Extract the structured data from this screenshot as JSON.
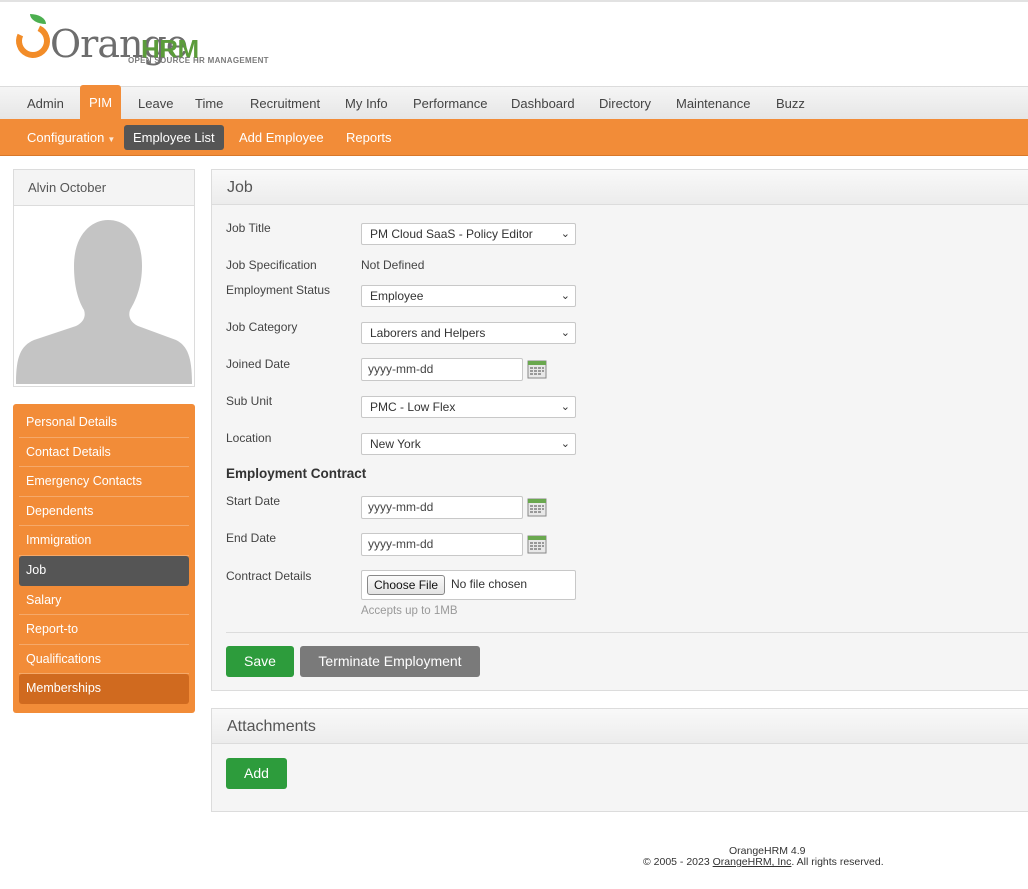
{
  "brand": {
    "logo_word": "Orange",
    "logo_hrm": "HRM",
    "logo_sub": "OPEN SOURCE HR MANAGEMENT"
  },
  "mainnav": {
    "items": [
      {
        "label": "Admin"
      },
      {
        "label": "PIM",
        "active": true
      },
      {
        "label": "Leave"
      },
      {
        "label": "Time"
      },
      {
        "label": "Recruitment"
      },
      {
        "label": "My Info"
      },
      {
        "label": "Performance"
      },
      {
        "label": "Dashboard"
      },
      {
        "label": "Directory"
      },
      {
        "label": "Maintenance"
      },
      {
        "label": "Buzz"
      }
    ]
  },
  "subnav": {
    "items": [
      {
        "label": "Configuration",
        "has_caret": true
      },
      {
        "label": "Employee List",
        "active": true
      },
      {
        "label": "Add Employee"
      },
      {
        "label": "Reports"
      }
    ]
  },
  "profile": {
    "name": "Alvin October",
    "photo_icon": "avatar-silhouette"
  },
  "sidemenu": {
    "items": [
      {
        "label": "Personal Details"
      },
      {
        "label": "Contact Details"
      },
      {
        "label": "Emergency Contacts"
      },
      {
        "label": "Dependents"
      },
      {
        "label": "Immigration"
      },
      {
        "label": "Job",
        "active": true
      },
      {
        "label": "Salary"
      },
      {
        "label": "Report-to"
      },
      {
        "label": "Qualifications"
      },
      {
        "label": "Memberships",
        "hover": true
      }
    ]
  },
  "job": {
    "title": "Job",
    "fields": {
      "job_title": {
        "label": "Job Title",
        "value": "PM Cloud SaaS - Policy Editor"
      },
      "job_spec": {
        "label": "Job Specification",
        "value": "Not Defined"
      },
      "employment_status": {
        "label": "Employment Status",
        "value": "Employee"
      },
      "job_category": {
        "label": "Job Category",
        "value": "Laborers and Helpers"
      },
      "joined_date": {
        "label": "Joined Date",
        "placeholder": "yyyy-mm-dd"
      },
      "sub_unit": {
        "label": "Sub Unit",
        "value": "PMC - Low Flex"
      },
      "location": {
        "label": "Location",
        "value": "New York"
      }
    },
    "contract": {
      "heading": "Employment Contract",
      "start_date": {
        "label": "Start Date",
        "placeholder": "yyyy-mm-dd"
      },
      "end_date": {
        "label": "End Date",
        "placeholder": "yyyy-mm-dd"
      },
      "details": {
        "label": "Contract Details",
        "button": "Choose File",
        "file_status": "No file chosen",
        "hint": "Accepts up to 1MB"
      }
    },
    "buttons": {
      "save": "Save",
      "terminate": "Terminate Employment"
    }
  },
  "attachments": {
    "title": "Attachments",
    "add": "Add"
  },
  "footer": {
    "version": "OrangeHRM 4.9",
    "copyright_prefix": "© 2005 - 2023 ",
    "company": "OrangeHRM, Inc",
    "copyright_suffix": ". All rights reserved."
  },
  "colors": {
    "accent": "#f28c38",
    "nav_active": "#555555",
    "button_green": "#2d9c3c",
    "button_grey": "#7a7a7a"
  }
}
